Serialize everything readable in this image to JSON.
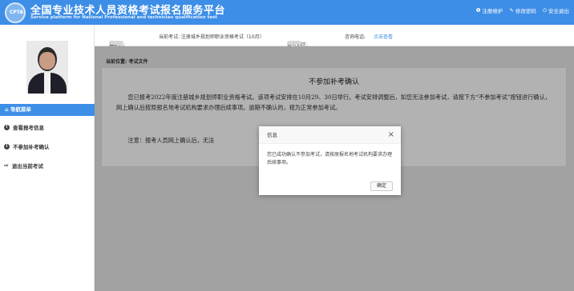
{
  "header": {
    "title_cn": "全国专业技术人员资格考试报名服务平台",
    "title_en": "Service platform for National Professional and technician qualification test",
    "links": [
      "注册维护",
      "修改密码",
      "安全退出"
    ]
  },
  "infobar": {
    "welcome": "欢迎您:",
    "current_exam": "当前考试: 注册城乡规划师职业资格考试（10月）",
    "exam_area": "报考地区:",
    "contact": "咨询电话:",
    "contact_link": "点击查看"
  },
  "sidebar": {
    "nav_title": "导航菜单",
    "items": [
      {
        "label": "查看报考信息"
      },
      {
        "label": "不参加补考确认"
      },
      {
        "label": "退出当前考试"
      }
    ]
  },
  "main": {
    "breadcrumb": "当前位置: 考试文件",
    "doc_title": "不参加补考确认",
    "para1": "您已报考2022年度注册城乡规划师职业资格考试。该项考试安排在10月29、30日举行。考试安排调整后，如您无法参加考试，请按下方“不参加考试”按钮进行确认，网上确认后按原报名地考试机构要求办理后续事项。逾期不确认的，视为正常参加考试。",
    "para2": "注意：报考人员网上确认后，无法"
  },
  "dialog": {
    "title": "信息",
    "message": "您已成功确认不参加考试，请按原报名地考试机构要求办理后续事项。",
    "ok": "确定"
  },
  "colors": {
    "accent": "#3d8ee6"
  }
}
